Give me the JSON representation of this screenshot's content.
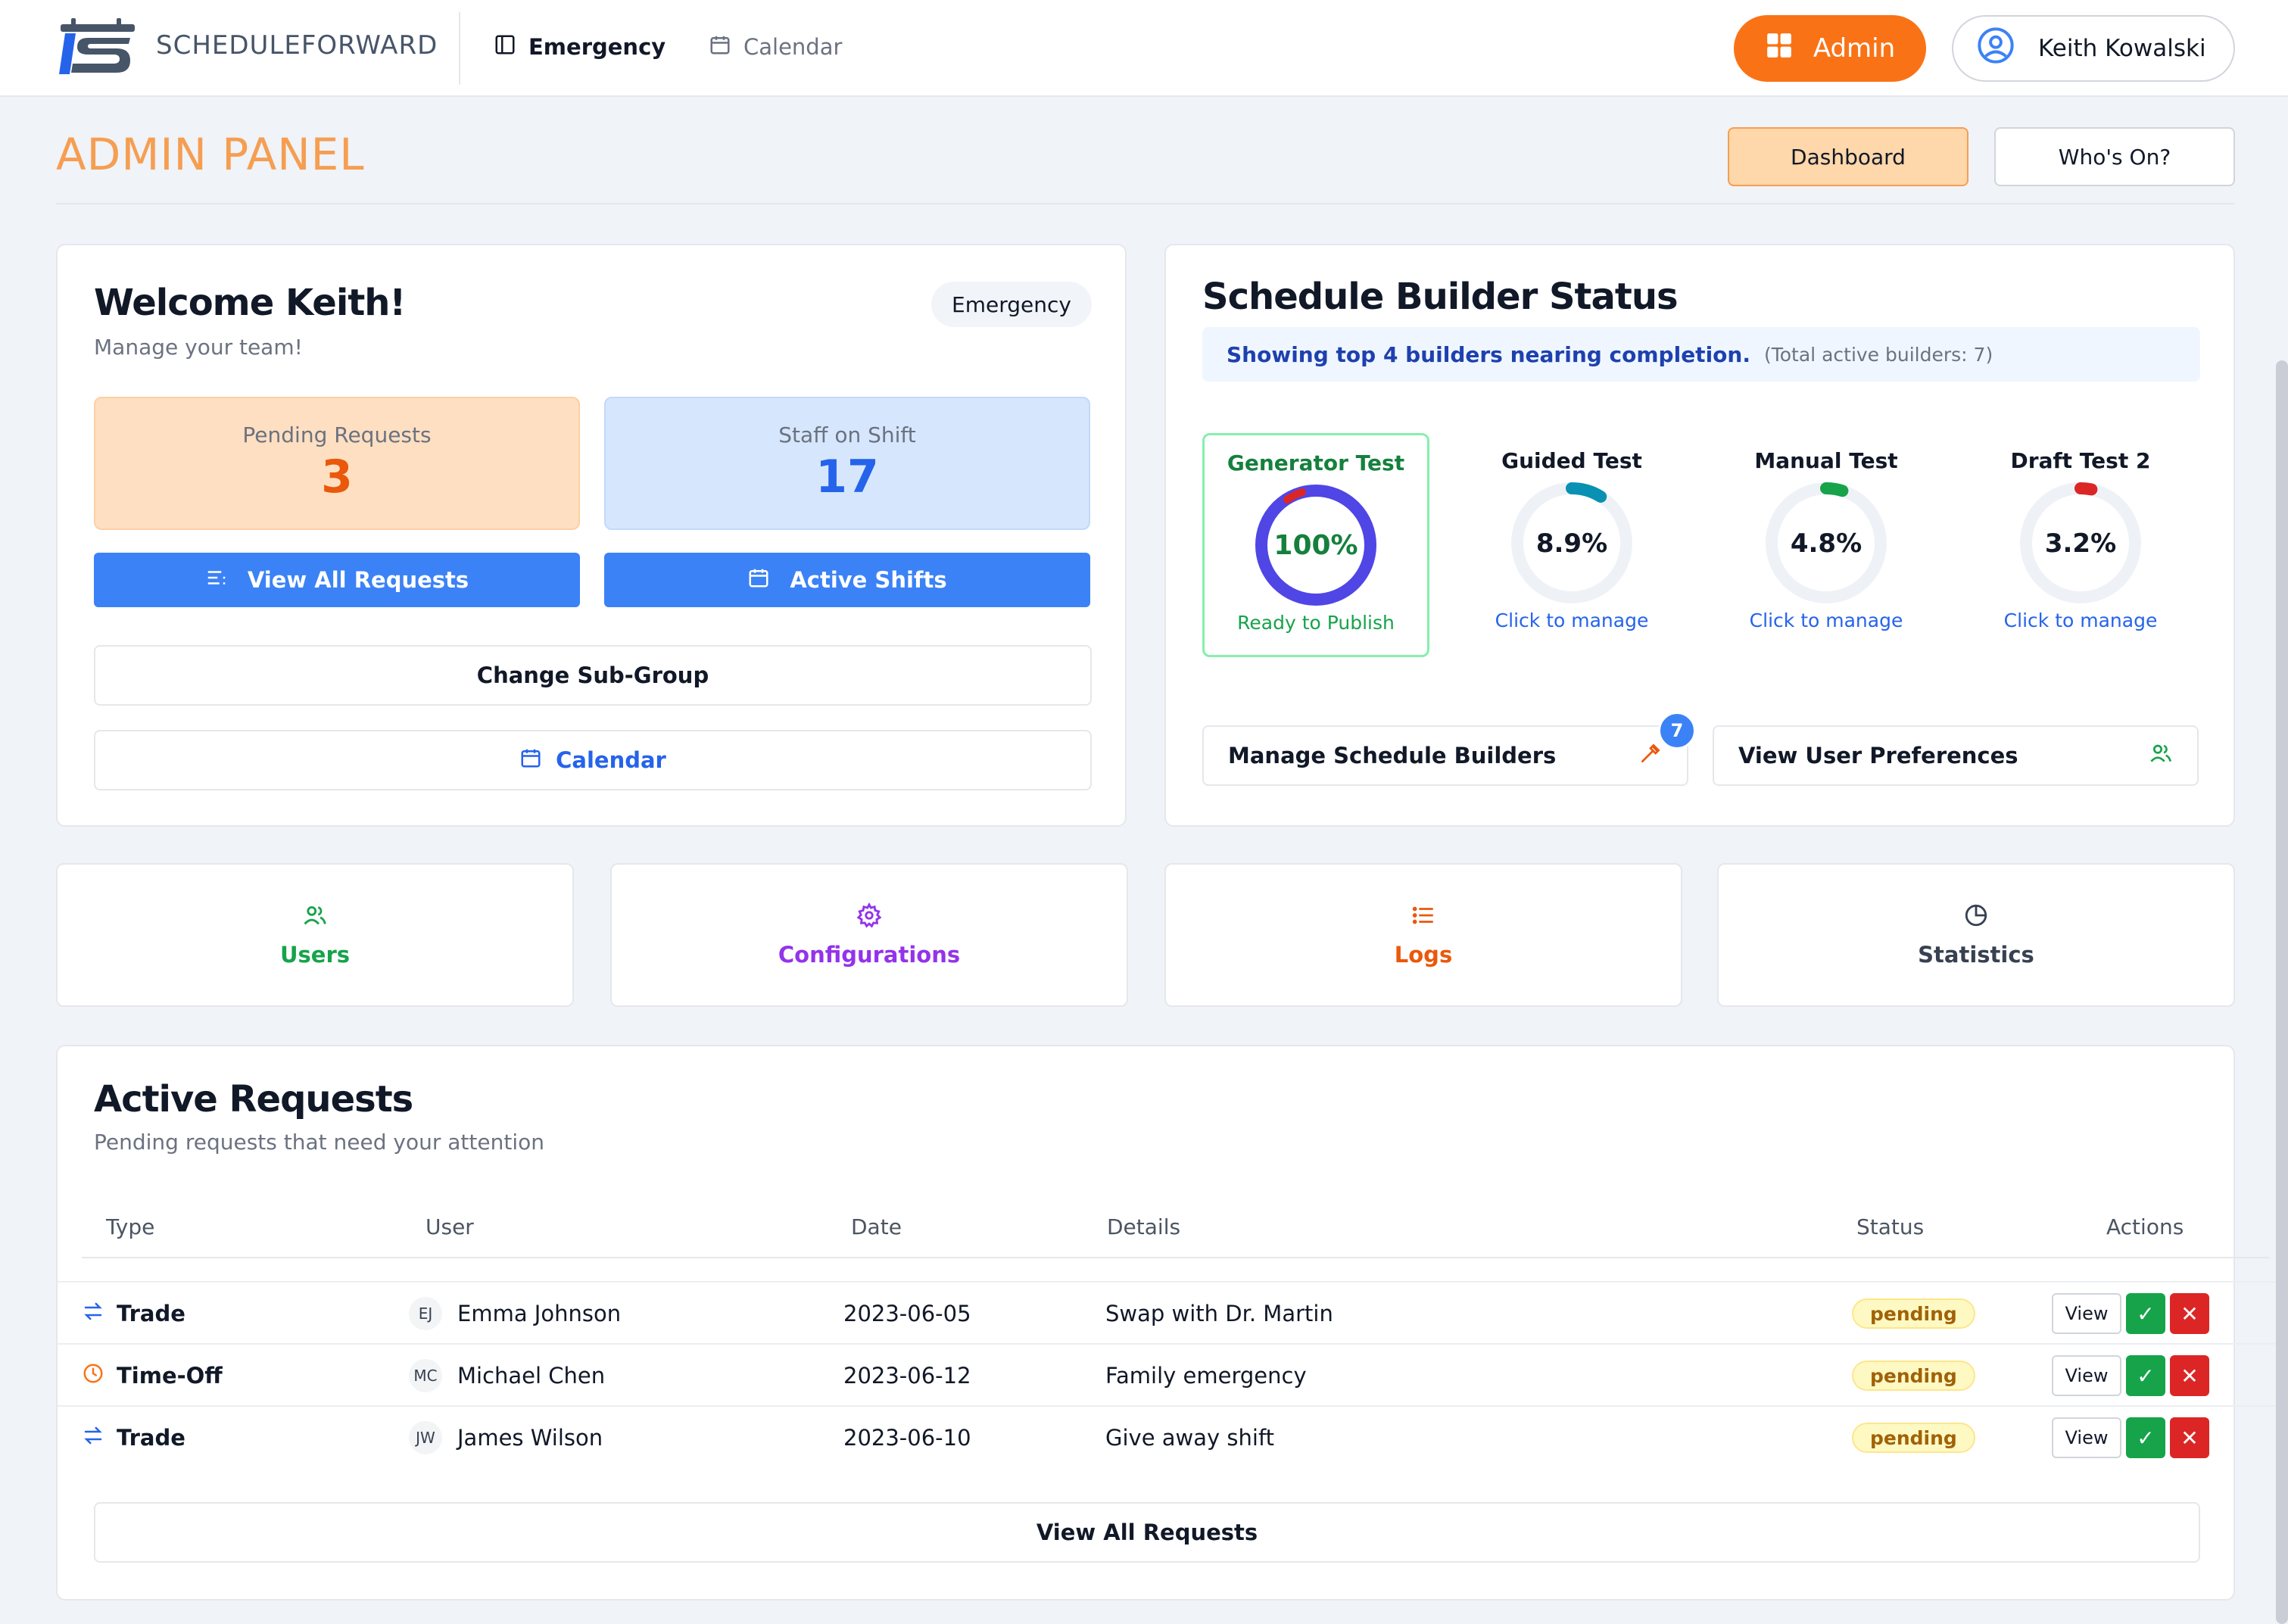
{
  "header": {
    "brand": "SCHEDULEFORWARD",
    "nav": [
      {
        "label": "Emergency",
        "icon": "sidebar-panel-icon"
      },
      {
        "label": "Calendar",
        "icon": "calendar-icon"
      }
    ],
    "admin_label": "Admin",
    "user_name": "Keith Kowalski"
  },
  "page": {
    "title": "ADMIN PANEL",
    "tabs": [
      "Dashboard",
      "Who's On?"
    ],
    "active_tab": "Dashboard"
  },
  "welcome": {
    "title": "Welcome Keith!",
    "subtitle": "Manage your team!",
    "group_chip": "Emergency",
    "stats": [
      {
        "label": "Pending Requests",
        "value": "3"
      },
      {
        "label": "Staff on Shift",
        "value": "17"
      }
    ],
    "buttons": {
      "view_requests": "View All Requests",
      "active_shifts": "Active Shifts",
      "change_subgroup": "Change Sub-Group",
      "calendar": "Calendar"
    }
  },
  "builder_status": {
    "title": "Schedule Builder Status",
    "banner_main": "Showing top 4 builders nearing completion.",
    "banner_note": "(Total active builders: 7)",
    "gauges": [
      {
        "name": "Generator Test",
        "percent_label": "100%",
        "progress": 1.0,
        "footer": "Ready to Publish",
        "color": "#4f46e5"
      },
      {
        "name": "Guided Test",
        "percent_label": "8.9%",
        "progress": 0.089,
        "footer": "Click to manage",
        "color": "#0891b2"
      },
      {
        "name": "Manual Test",
        "percent_label": "4.8%",
        "progress": 0.048,
        "footer": "Click to manage",
        "color": "#16a34a"
      },
      {
        "name": "Draft Test 2",
        "percent_label": "3.2%",
        "progress": 0.032,
        "footer": "Click to manage",
        "color": "#dc2626"
      }
    ],
    "manage_label": "Manage Schedule Builders",
    "manage_count": "7",
    "preferences_label": "View User Preferences"
  },
  "quick_links": [
    {
      "label": "Users",
      "icon": "users-icon",
      "color": "#16a34a"
    },
    {
      "label": "Configurations",
      "icon": "gear-icon",
      "color": "#9333ea"
    },
    {
      "label": "Logs",
      "icon": "list-icon",
      "color": "#ea580c"
    },
    {
      "label": "Statistics",
      "icon": "pie-chart-icon",
      "color": "#374151"
    }
  ],
  "requests": {
    "title": "Active Requests",
    "subtitle": "Pending requests that need your attention",
    "columns": [
      "Type",
      "User",
      "Date",
      "Details",
      "Status",
      "Actions"
    ],
    "rows": [
      {
        "type": "Trade",
        "initials": "EJ",
        "user": "Emma Johnson",
        "date": "2023-06-05",
        "details": "Swap with Dr. Martin",
        "status": "pending"
      },
      {
        "type": "Time-Off",
        "initials": "MC",
        "user": "Michael Chen",
        "date": "2023-06-12",
        "details": "Family emergency",
        "status": "pending"
      },
      {
        "type": "Trade",
        "initials": "JW",
        "user": "James Wilson",
        "date": "2023-06-10",
        "details": "Give away shift",
        "status": "pending"
      }
    ],
    "view_label": "View",
    "approve_glyph": "✓",
    "reject_glyph": "✕",
    "footer_button": "View All Requests"
  }
}
